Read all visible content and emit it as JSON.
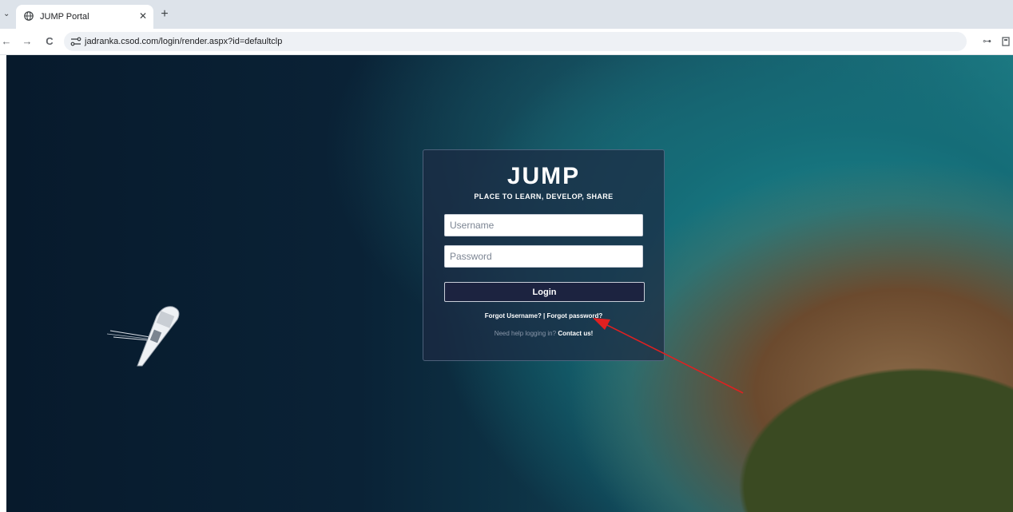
{
  "browser": {
    "tab_title": "JUMP Portal",
    "tab_close": "✕",
    "new_tab": "+",
    "url": "jadranka.csod.com/login/render.aspx?id=defaultclp",
    "back": "←",
    "forward": "→",
    "reload": "C",
    "key_icon": "⊶"
  },
  "login": {
    "brand": "JUMP",
    "tagline": "PLACE TO LEARN, DEVELOP, SHARE",
    "username_placeholder": "Username",
    "password_placeholder": "Password",
    "login_label": "Login",
    "forgot_username": "Forgot Username?",
    "separator": " | ",
    "forgot_password": "Forgot password?",
    "help_text": "Need help logging in? ",
    "contact_label": "Contact us!"
  },
  "annotation": {
    "arrow_color": "#e02020"
  }
}
